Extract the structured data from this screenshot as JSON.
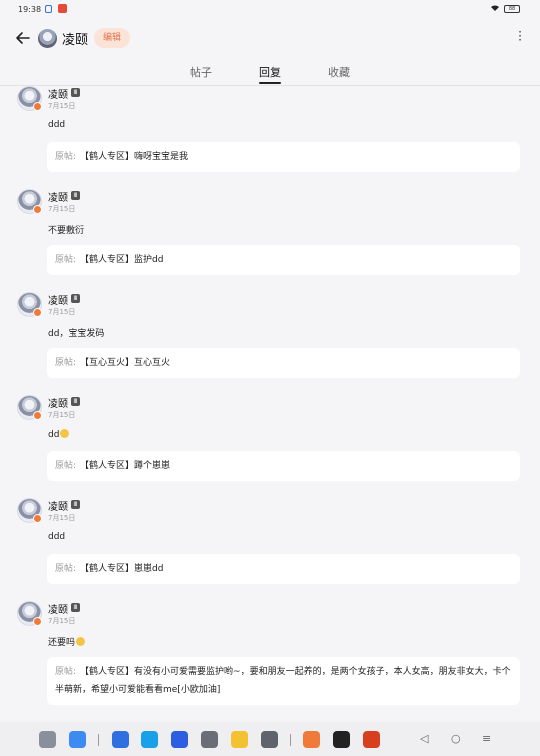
{
  "status": {
    "time": "19:38",
    "battery": "88"
  },
  "header": {
    "username": "凌颐",
    "edit_label": "编辑"
  },
  "tabs": [
    {
      "label": "帖子",
      "active": false
    },
    {
      "label": "回复",
      "active": true
    },
    {
      "label": "收藏",
      "active": false
    }
  ],
  "quote_prefix": "原帖:",
  "posts": [
    {
      "name": "凌颐",
      "level": "Ⅲ",
      "date": "7月15日",
      "body": "ddd",
      "emoji": false,
      "quote": "【鹤人专区】嗨呀宝宝是我"
    },
    {
      "name": "凌颐",
      "level": "Ⅲ",
      "date": "7月15日",
      "body": "不要敷衍",
      "emoji": false,
      "quote": "【鹤人专区】监护dd"
    },
    {
      "name": "凌颐",
      "level": "Ⅲ",
      "date": "7月15日",
      "body": "dd，宝宝发码",
      "emoji": false,
      "quote": "【互心互火】互心互火"
    },
    {
      "name": "凌颐",
      "level": "Ⅲ",
      "date": "7月15日",
      "body": "dd",
      "emoji": true,
      "quote": "【鹤人专区】蹲个崽崽"
    },
    {
      "name": "凌颐",
      "level": "Ⅲ",
      "date": "7月15日",
      "body": "ddd",
      "emoji": false,
      "quote": "【鹤人专区】崽崽dd"
    },
    {
      "name": "凌颐",
      "level": "Ⅲ",
      "date": "7月15日",
      "body": "还要吗",
      "emoji": true,
      "quote": "【鹤人专区】有没有小可爱需要监护哟~，要和朋友一起养的，是两个女孩子，本人女高，朋友非女大，卡个半萌新，希望小可爱能看看me[小欧加油]"
    }
  ],
  "dock": {
    "apps": [
      {
        "name": "app-grid-icon",
        "color": "#8a8f9c"
      },
      {
        "name": "files-icon",
        "color": "#3d8bf2"
      },
      {
        "name": "folder-icon",
        "color": "#2f6fe0"
      },
      {
        "name": "browser-icon",
        "color": "#1aa0e8"
      },
      {
        "name": "gallery-icon",
        "color": "#2d5de0"
      },
      {
        "name": "camera-icon",
        "color": "#6b6e76"
      },
      {
        "name": "notes-icon",
        "color": "#f2c230"
      },
      {
        "name": "settings-icon",
        "color": "#5f636c"
      },
      {
        "name": "game-app-icon",
        "color": "#f07a3a"
      },
      {
        "name": "qq-icon",
        "color": "#222222"
      },
      {
        "name": "video-app-icon",
        "color": "#d6401f"
      }
    ]
  }
}
